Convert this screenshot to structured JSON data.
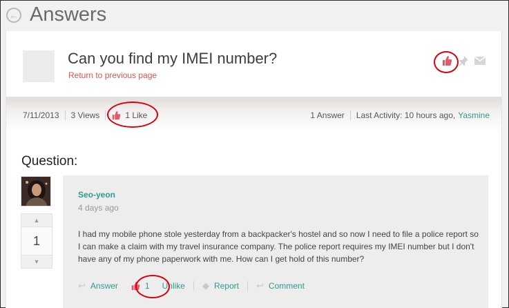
{
  "header": {
    "title": "Answers",
    "back_icon": "back-arrow-icon"
  },
  "question": {
    "title": "Can you find my IMEI number?",
    "return_link": "Return to previous page"
  },
  "stats": {
    "date": "7/11/2013",
    "views": "3 Views",
    "likes": "1 Like",
    "answers": "1 Answer",
    "last_activity_label": "Last Activity: 10 hours ago,",
    "last_activity_user": "Yasmine"
  },
  "section_label": "Question:",
  "post": {
    "author": "Seo-yeon",
    "date": "4 days ago",
    "body": "I had my mobile phone stole yesterday from a backpacker's hostel and so now I need to file a police report so I can make a claim with my travel insurance company. The police report requires my IMEI number but I don't have any of my phone paperwork with me. How can I get hold of this number?",
    "vote_count": "1",
    "actions": {
      "answer": "Answer",
      "like_count": "1",
      "unlike": "Unlike",
      "report": "Report",
      "comment": "Comment"
    }
  },
  "colors": {
    "accent_teal": "#2e9a8c",
    "like_red": "#e05a6a",
    "highlight_ring": "#d8000c"
  }
}
